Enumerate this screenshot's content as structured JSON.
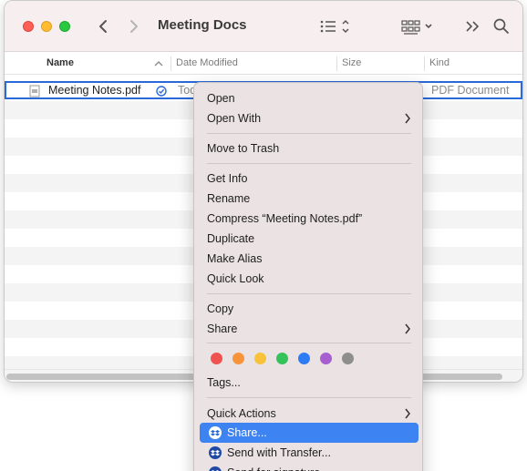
{
  "window": {
    "title": "Meeting Docs"
  },
  "columns": {
    "name": "Name",
    "date": "Date Modified",
    "size": "Size",
    "kind": "Kind"
  },
  "file": {
    "name": "Meeting Notes.pdf",
    "date_partial": "Tod",
    "kind": "PDF Document"
  },
  "menu": {
    "open": "Open",
    "open_with": "Open With",
    "move_to_trash": "Move to Trash",
    "get_info": "Get Info",
    "rename": "Rename",
    "compress": "Compress “Meeting Notes.pdf”",
    "duplicate": "Duplicate",
    "make_alias": "Make Alias",
    "quick_look": "Quick Look",
    "copy": "Copy",
    "share": "Share",
    "tags": "Tags...",
    "quick_actions": "Quick Actions",
    "dropbox_share": "Share...",
    "send_with_transfer": "Send with Transfer...",
    "send_partial": "Send for signature..."
  },
  "tag_colors": [
    "#f0524f",
    "#f7943a",
    "#f8c33a",
    "#35c25a",
    "#2d7cf6",
    "#a65ed0",
    "#8e8e8e"
  ],
  "colors": {
    "highlight": "#3d84f2",
    "selection_border": "#2a6ad8"
  }
}
